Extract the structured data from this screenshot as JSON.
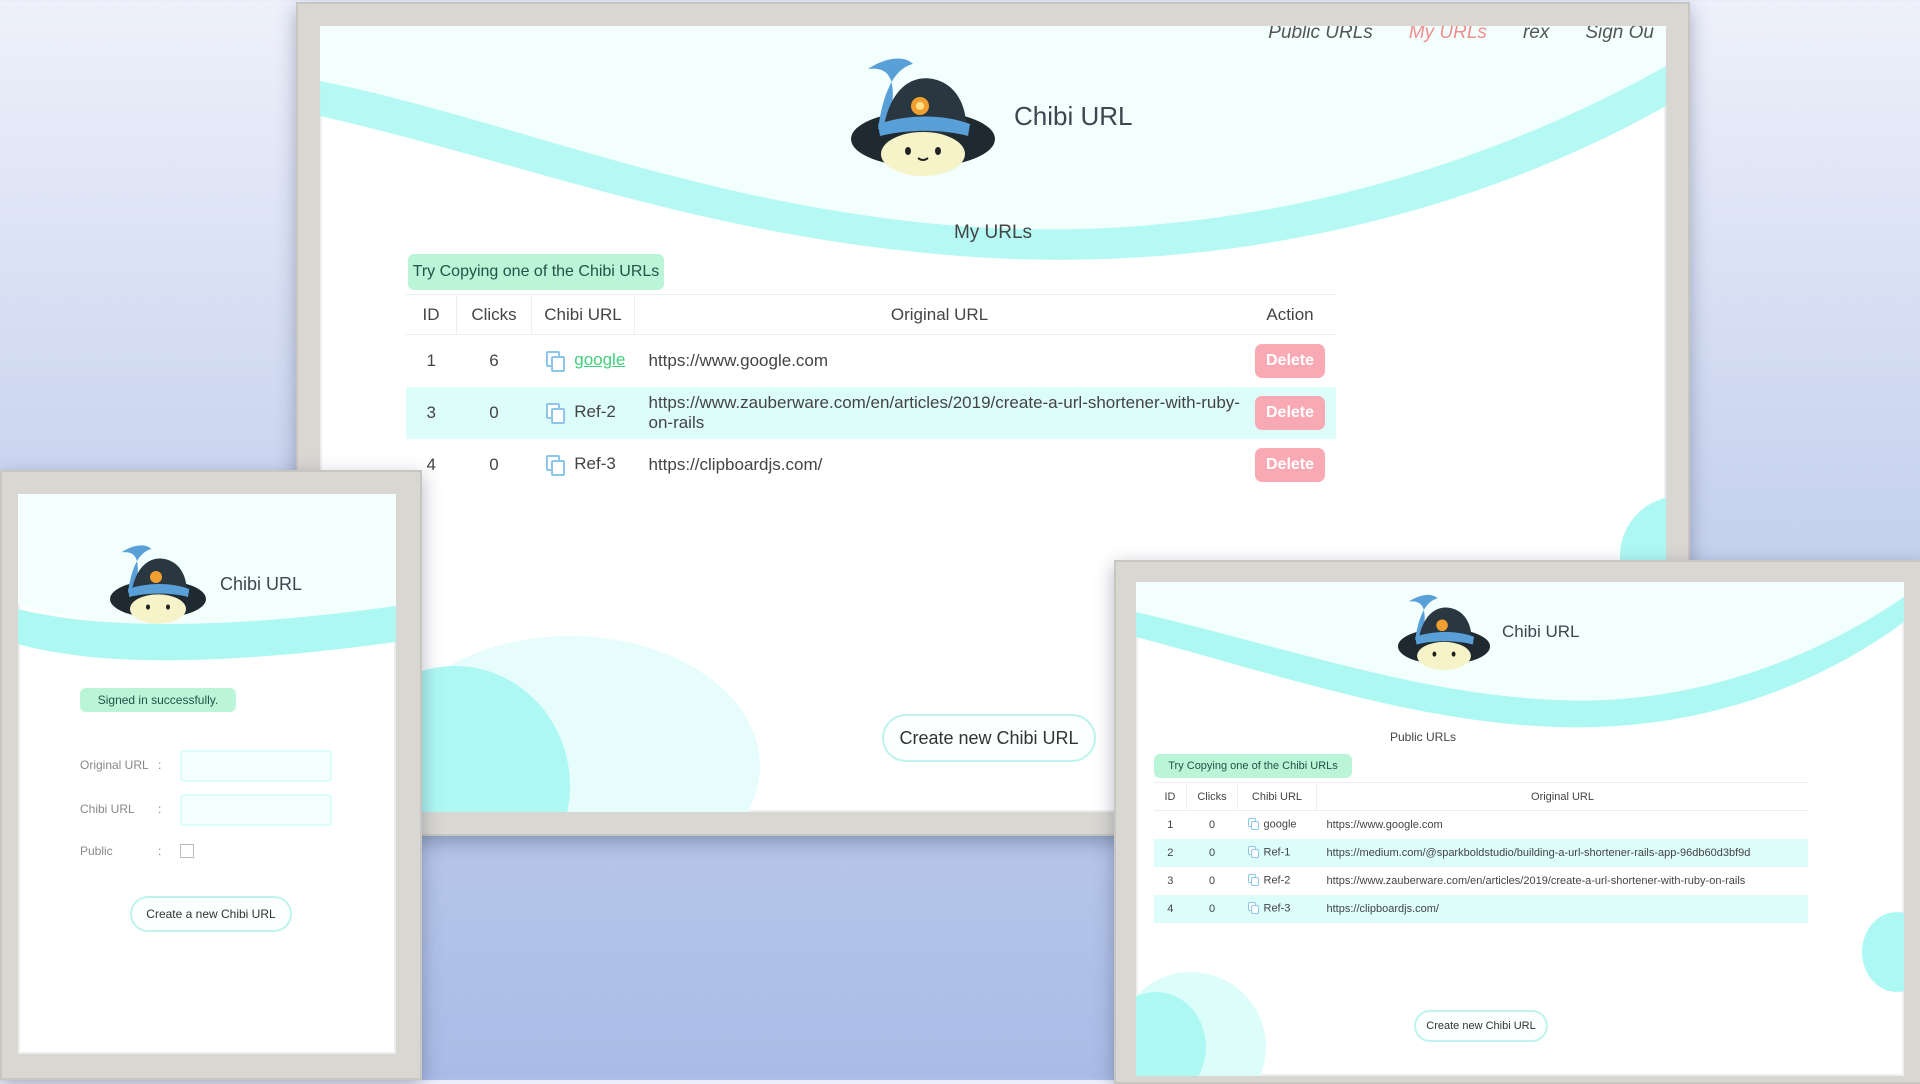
{
  "colors": {
    "teal": "#aef8f3",
    "teal_light": "#dcfdfa",
    "green_pill": "#b9f5d6",
    "delete": "#f9a9b3",
    "link_green": "#3fd17a",
    "nav_active": "#f08c8c"
  },
  "main": {
    "nav": {
      "public": "Public URLs",
      "my": "My URLs",
      "user": "rex",
      "signout": "Sign Ou"
    },
    "brand": "Chibi URL",
    "page_title": "My URLs",
    "hint": "Try Copying one of the Chibi URLs",
    "headers": {
      "id": "ID",
      "clicks": "Clicks",
      "chibi": "Chibi URL",
      "original": "Original URL",
      "action": "Action"
    },
    "rows": [
      {
        "id": "1",
        "clicks": "6",
        "chibi": "google",
        "original": "https://www.google.com",
        "action": "Delete"
      },
      {
        "id": "3",
        "clicks": "0",
        "chibi": "Ref-2",
        "original": "https://www.zauberware.com/en/articles/2019/create-a-url-shortener-with-ruby-on-rails",
        "action": "Delete"
      },
      {
        "id": "4",
        "clicks": "0",
        "chibi": "Ref-3",
        "original": "https://clipboardjs.com/",
        "action": "Delete"
      }
    ],
    "create_button": "Create new Chibi URL"
  },
  "left": {
    "brand": "Chibi URL",
    "flash": "Signed in successfully.",
    "original_label": "Original URL",
    "chibi_label": "Chibi URL",
    "public_label": "Public",
    "colon": ":",
    "submit": "Create a new Chibi URL"
  },
  "right": {
    "brand": "Chibi URL",
    "page_title": "Public URLs",
    "hint": "Try Copying one of the Chibi URLs",
    "headers": {
      "id": "ID",
      "clicks": "Clicks",
      "chibi": "Chibi URL",
      "original": "Original URL"
    },
    "rows": [
      {
        "id": "1",
        "clicks": "0",
        "chibi": "google",
        "original": "https://www.google.com"
      },
      {
        "id": "2",
        "clicks": "0",
        "chibi": "Ref-1",
        "original": "https://medium.com/@sparkboldstudio/building-a-url-shortener-rails-app-96db60d3bf9d"
      },
      {
        "id": "3",
        "clicks": "0",
        "chibi": "Ref-2",
        "original": "https://www.zauberware.com/en/articles/2019/create-a-url-shortener-with-ruby-on-rails"
      },
      {
        "id": "4",
        "clicks": "0",
        "chibi": "Ref-3",
        "original": "https://clipboardjs.com/"
      }
    ],
    "create_button": "Create new Chibi URL"
  }
}
